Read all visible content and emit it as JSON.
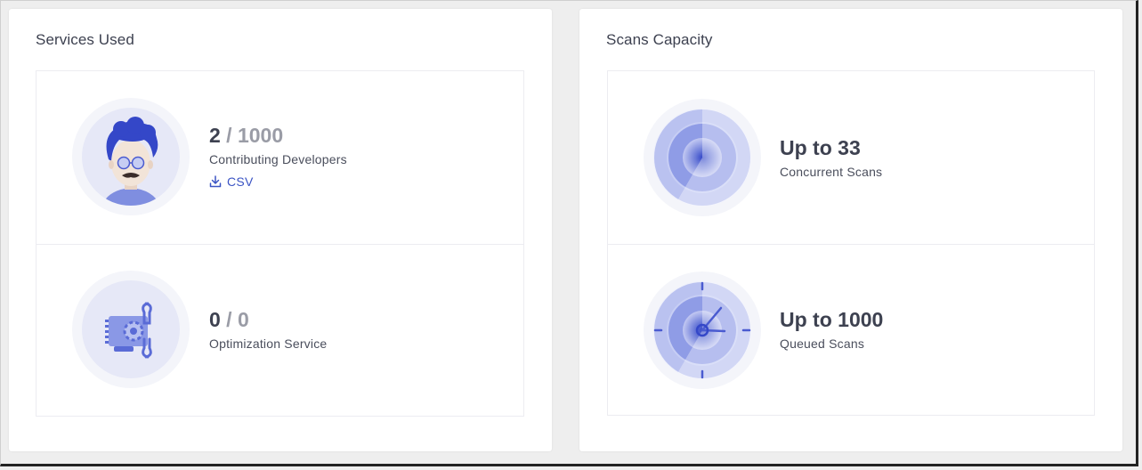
{
  "services": {
    "title": "Services Used",
    "developers": {
      "used": "2",
      "separator": " / ",
      "limit": "1000",
      "label": "Contributing Developers",
      "csv_label": "CSV"
    },
    "optimization": {
      "used": "0",
      "separator": " / ",
      "limit": "0",
      "label": "Optimization Service"
    }
  },
  "capacity": {
    "title": "Scans Capacity",
    "concurrent": {
      "value": "Up to 33",
      "label": "Concurrent Scans"
    },
    "queued": {
      "value": "Up to 1000",
      "label": "Queued Scans"
    }
  },
  "colors": {
    "accent": "#3b54c4",
    "text": "#3d4150",
    "muted": "#9a9ca6"
  }
}
